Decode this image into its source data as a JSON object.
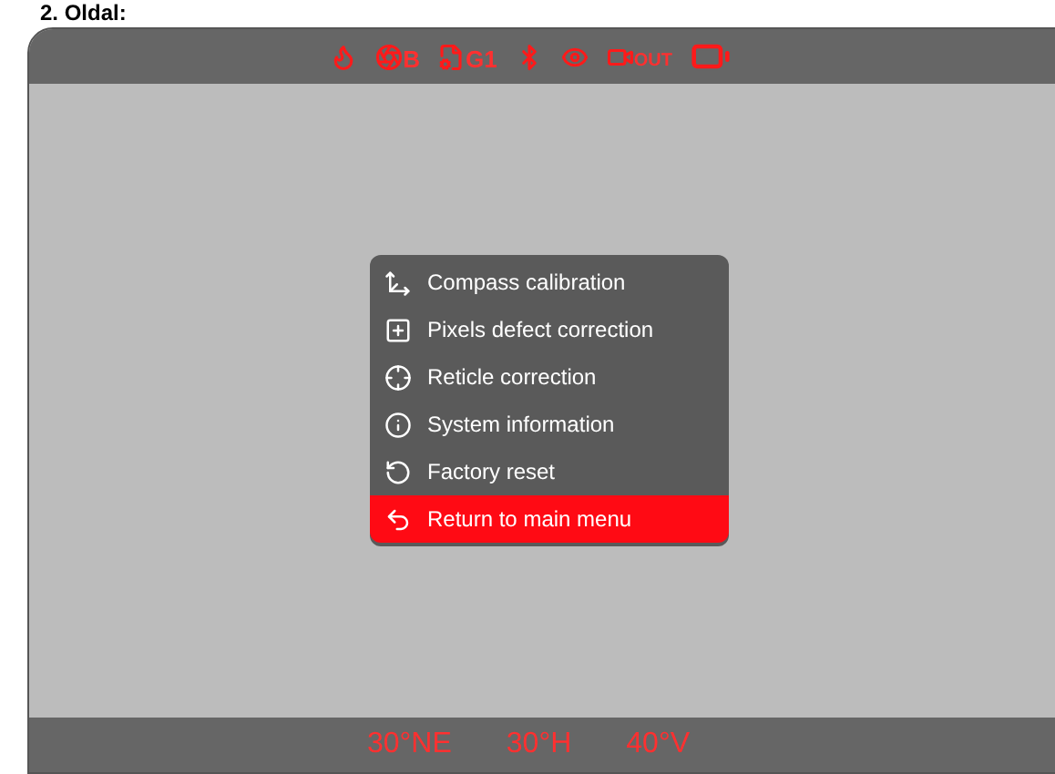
{
  "caption": "2. Oldal:",
  "status_bar": [
    {
      "kind": "flame"
    },
    {
      "kind": "shutter",
      "label": "B"
    },
    {
      "kind": "profile",
      "label": "G1"
    },
    {
      "kind": "bluetooth"
    },
    {
      "kind": "eye"
    },
    {
      "kind": "video",
      "label": "OUT"
    },
    {
      "kind": "battery"
    }
  ],
  "menu": [
    {
      "kind": "compass",
      "label": "Compass calibration",
      "selected": false
    },
    {
      "kind": "pixels",
      "label": "Pixels defect correction",
      "selected": false
    },
    {
      "kind": "reticle",
      "label": "Reticle correction",
      "selected": false
    },
    {
      "kind": "info",
      "label": "System information",
      "selected": false
    },
    {
      "kind": "reset",
      "label": "Factory reset",
      "selected": false
    },
    {
      "kind": "return",
      "label": "Return to main menu",
      "selected": true
    }
  ],
  "readouts": [
    "30°NE",
    "30°H",
    "40°V"
  ]
}
